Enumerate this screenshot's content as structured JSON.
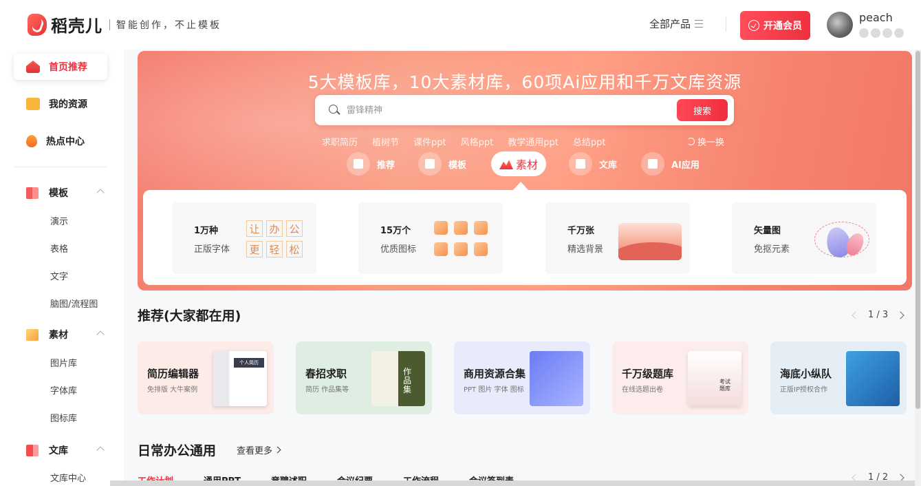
{
  "header": {
    "logo_text": "稻壳儿",
    "slogan": "智能创作，不止模板",
    "all_products": "全部产品",
    "vip_button": "开通会员",
    "username": "peach"
  },
  "sidebar": {
    "main": [
      {
        "label": "首页推荐",
        "icon": "home-icon"
      },
      {
        "label": "我的资源",
        "icon": "folder-icon"
      },
      {
        "label": "热点中心",
        "icon": "fire-icon"
      }
    ],
    "groups": [
      {
        "label": "模板",
        "icon": "template-icon",
        "items": [
          "演示",
          "表格",
          "文字",
          "脑图/流程图"
        ]
      },
      {
        "label": "素材",
        "icon": "material-icon",
        "items": [
          "图片库",
          "字体库",
          "图标库"
        ]
      },
      {
        "label": "文库",
        "icon": "library-icon",
        "items": [
          "文库中心"
        ]
      }
    ]
  },
  "hero": {
    "title": "5大模板库，10大素材库，60项Ai应用和千万文库资源",
    "search_placeholder": "雷锋精神",
    "search_button": "搜索",
    "hot_tags": [
      "求职简历",
      "植树节",
      "课件ppt",
      "风格ppt",
      "教学通用ppt",
      "总结ppt"
    ],
    "shuffle": "换一换",
    "tabs": [
      "推荐",
      "模板",
      "素材",
      "文库",
      "AI应用"
    ],
    "active_tab": "素材",
    "material_cards": [
      {
        "num": "1万种",
        "desc": "正版字体",
        "glyphs": [
          "让",
          "办",
          "公",
          "更",
          "轻",
          "松"
        ]
      },
      {
        "num": "15万个",
        "desc": "优质图标"
      },
      {
        "num": "千万张",
        "desc": "精选背景"
      },
      {
        "num": "矢量图",
        "desc": "免抠元素"
      }
    ]
  },
  "recommend": {
    "title": "推荐(大家都在用)",
    "page": "1 / 3",
    "cards": [
      {
        "title": "简历编辑器",
        "sub": "免排版 大牛案例",
        "art_text": "个人简历",
        "bg": "#fdebe8"
      },
      {
        "title": "春招求职",
        "sub": "简历 作品集等",
        "art_text": "作品集",
        "bg": "#dfeee3"
      },
      {
        "title": "商用资源合集",
        "sub": "PPT 图片 字体 图标",
        "art_text": "",
        "bg": "#e7ebfb"
      },
      {
        "title": "千万级题库",
        "sub": "在线选题出卷",
        "art_text": "考试题库",
        "bg": "#fcecec"
      },
      {
        "title": "海底小纵队",
        "sub": "正版IP授权合作",
        "art_text": "",
        "bg": "#e4eef4"
      }
    ]
  },
  "daily": {
    "title": "日常办公通用",
    "see_more": "查看更多",
    "page": "1 / 2",
    "tabs": [
      "工作计划",
      "通用PPT",
      "竞聘述职",
      "会议纪要",
      "工作流程",
      "会议签到表"
    ]
  }
}
